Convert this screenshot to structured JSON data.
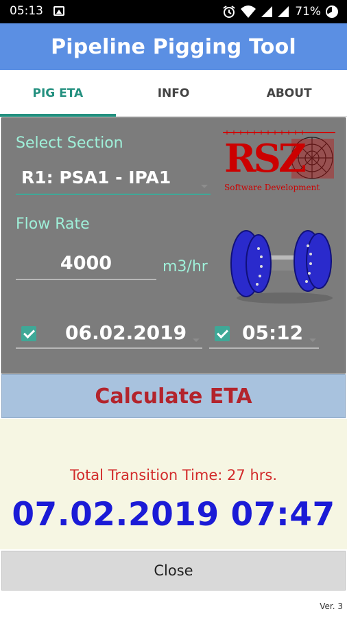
{
  "status_bar": {
    "time": "05:13",
    "battery_pct": "71%",
    "icons": [
      "image-icon",
      "alarm-icon",
      "wifi-icon",
      "signal-icon",
      "signal-icon",
      "battery-icon"
    ]
  },
  "app": {
    "title": "Pipeline Pigging Tool"
  },
  "tabs": [
    {
      "label": "PIG ETA",
      "active": true
    },
    {
      "label": "INFO",
      "active": false
    },
    {
      "label": "ABOUT",
      "active": false
    }
  ],
  "form": {
    "section_label": "Select Section",
    "section_value": "R1: PSA1 - IPA1",
    "flow_label": "Flow Rate",
    "flow_value": "4000",
    "flow_unit": "m3/hr",
    "date_value": "06.02.2019",
    "date_checked": true,
    "time_value": "05:12",
    "time_checked": true
  },
  "logo": {
    "text": "Software Development"
  },
  "calculate_button": {
    "label": "Calculate ETA"
  },
  "result": {
    "transition_text": "Total Transition Time: 27 hrs.",
    "eta": "07.02.2019 07:47"
  },
  "close_button": {
    "label": "Close"
  },
  "version": "Ver. 3",
  "colors": {
    "title_bar": "#5b8fe3",
    "accent_teal": "#23907f",
    "panel_bg": "#7c7c7c",
    "label_mint": "#9ff0d9",
    "calc_text": "#b3242c",
    "eta_blue": "#1b1bd6",
    "transition_red": "#d22b2b"
  }
}
